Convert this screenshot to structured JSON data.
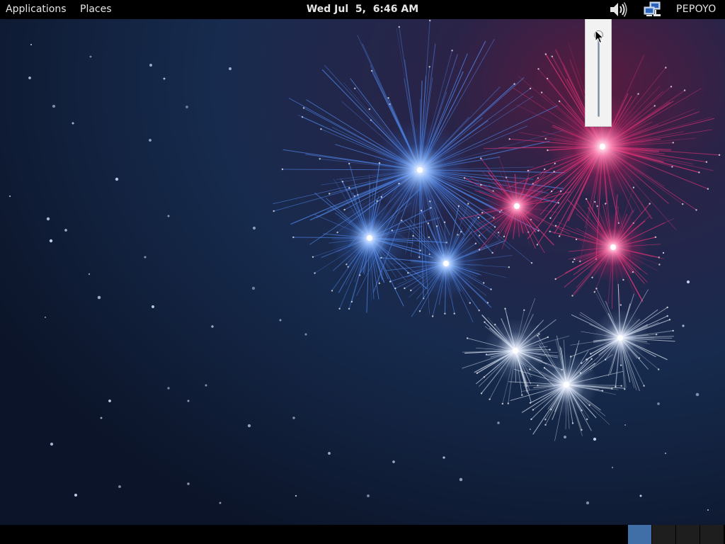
{
  "top_panel": {
    "applications_label": "Applications",
    "places_label": "Places",
    "clock": "Wed Jul  5,  6:46 AM",
    "user_name": "PEPOYO",
    "volume_icon": "speaker-volume-high-icon",
    "network_icon": "network-wired-computers-icon"
  },
  "volume_popup": {
    "level": 1.0,
    "accent_color": "#6a90c8"
  },
  "wallpaper": {
    "theme": "fireworks-night-sky",
    "colors": {
      "sky_top": "#0b1428",
      "sky_bottom": "#1c3358",
      "blue": "#4f86e8",
      "pink": "#e8347a",
      "white": "#dfe8f5"
    }
  },
  "bottom_panel": {
    "workspaces": [
      {
        "active": true
      },
      {
        "active": false
      },
      {
        "active": false
      },
      {
        "active": false
      }
    ]
  }
}
